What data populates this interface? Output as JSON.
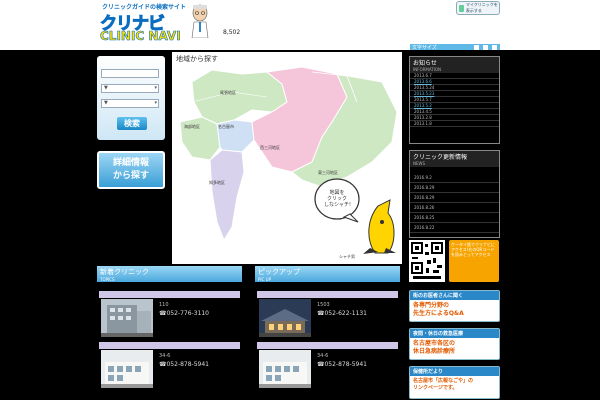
{
  "header": {
    "tagline": "クリニックガイドの検索サイト",
    "logo_kana": "クリナビ",
    "logo_en": "CLINIC NAVI",
    "counter": "8,502",
    "my_clinic": "マイクリニックを表示する",
    "font_size_label": "文字サイズ"
  },
  "search": {
    "select1": "▼",
    "select2": "▼",
    "button": "検索"
  },
  "detail_search": {
    "line1": "詳細情報",
    "line2": "から探す"
  },
  "map": {
    "title": "地域から探す",
    "regions": [
      "尾張地区",
      "海部地区",
      "名古屋市",
      "知多地区",
      "西三河地区",
      "東三河地区"
    ],
    "bubble": [
      "地図を",
      "クリック",
      "しなシャチ!"
    ],
    "mascot_label": "シャチ男"
  },
  "news": {
    "title": "お知らせ",
    "subtitle": "INFORMATION",
    "dates": [
      {
        "text": "2013.6.7",
        "link": false
      },
      {
        "text": "2013.6.6",
        "link": true
      },
      {
        "text": "2013.5.24",
        "link": false
      },
      {
        "text": "2013.5.23",
        "link": true
      },
      {
        "text": "2013.5.7",
        "link": false
      },
      {
        "text": "2013.5.2",
        "link": true
      },
      {
        "text": "2013.4.5",
        "link": false
      },
      {
        "text": "2013.2.8",
        "link": false
      },
      {
        "text": "2013.1.8",
        "link": false
      }
    ]
  },
  "updates": {
    "title": "クリニック更新情報",
    "subtitle": "NEWS",
    "dates": [
      "2016.9.2",
      "2016.8.29",
      "2016.8.29",
      "2016.8.26",
      "2016.8.25",
      "2016.8.22"
    ]
  },
  "qr": {
    "phone_text": "ケータイ版でクリナビにアクセス!右のQRコードを読みとってアクセス"
  },
  "banners": [
    {
      "head": "街のお医者さんに聞く",
      "body": [
        "各専門分野の",
        "先生方によるQ&A"
      ]
    },
    {
      "head": "夜間・休日の救急医療",
      "body": [
        "名古屋市各区の",
        "休日急病診療所"
      ]
    },
    {
      "head": "保健所だより",
      "body": [
        "名古屋市「広報なごや」の",
        "リンクページです。"
      ]
    }
  ],
  "new_clinics": {
    "title": "新着クリニック",
    "subtitle": "TOPICS",
    "items": [
      {
        "addr": "110",
        "phone": "☎052-776-3110"
      },
      {
        "addr": "34-6",
        "phone": "☎052-878-5941"
      }
    ]
  },
  "pickup": {
    "title": "ピックアップ",
    "subtitle": "PIC UP",
    "items": [
      {
        "addr": "1503",
        "phone": "☎052-622-1131"
      },
      {
        "addr": "34-6",
        "phone": "☎052-878-5941"
      }
    ]
  }
}
